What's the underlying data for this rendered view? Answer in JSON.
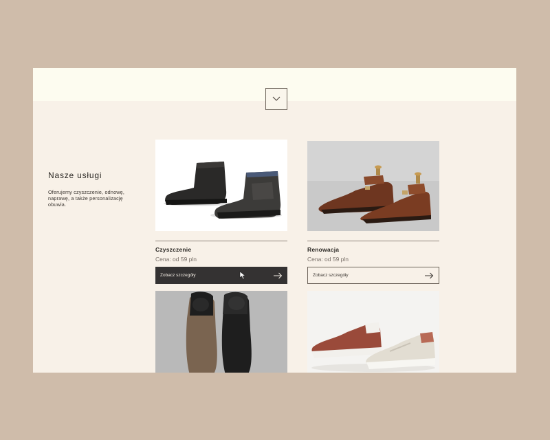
{
  "section": {
    "title": "Nasze usługi",
    "description": "Oferujemy czyszczenie, odnowę, naprawę, a także personalizację obuwia."
  },
  "scroll_button": {
    "icon": "chevron-down-icon"
  },
  "services": [
    {
      "name": "Czyszczenie",
      "price": "Cena: od 59 pln",
      "cta_label": "Zobacz szczegóły",
      "style": "dark"
    },
    {
      "name": "Renowacja",
      "price": "Cena: od 59 pln",
      "cta_label": "Zobacz szczegóły",
      "style": "light"
    }
  ],
  "colors": {
    "page_background": "#cfbcaa",
    "panel_background": "#f8f1e8",
    "topbar_background": "#fdfcf0",
    "dark_button": "#343232",
    "text_dark": "#2a2723",
    "text_muted": "#7a716a"
  }
}
